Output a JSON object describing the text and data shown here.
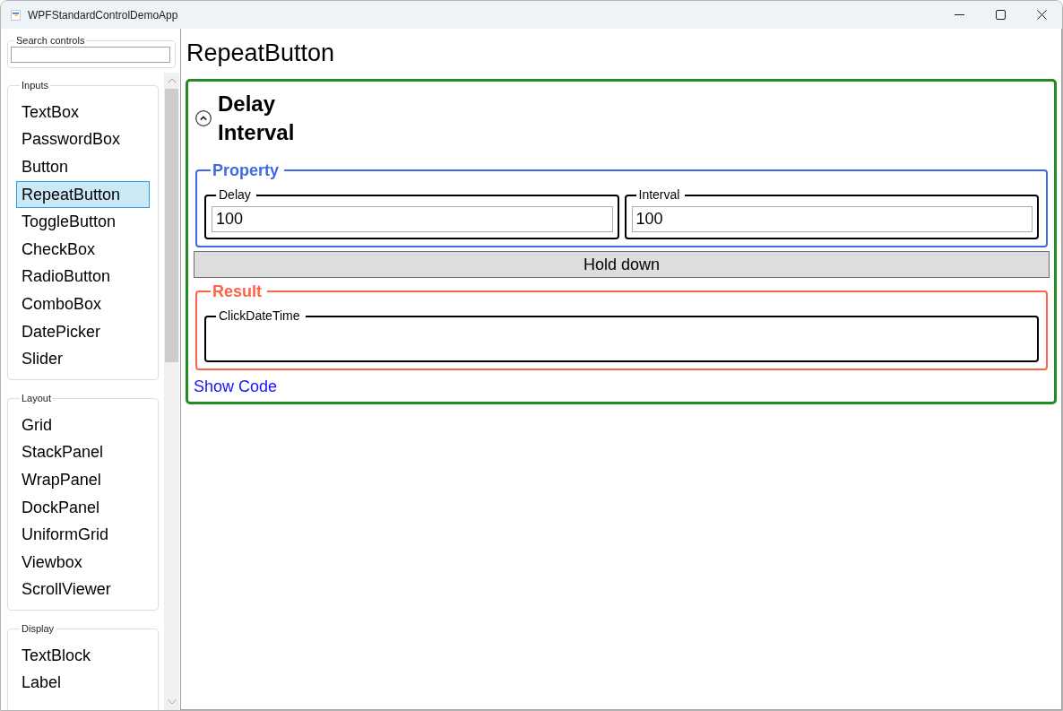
{
  "window": {
    "title": "WPFStandardControlDemoApp"
  },
  "sidebar": {
    "search": {
      "label": "Search controls"
    },
    "groups": [
      {
        "header": "Inputs",
        "items": [
          {
            "label": "TextBox",
            "selected": false
          },
          {
            "label": "PasswordBox",
            "selected": false
          },
          {
            "label": "Button",
            "selected": false
          },
          {
            "label": "RepeatButton",
            "selected": true
          },
          {
            "label": "ToggleButton",
            "selected": false
          },
          {
            "label": "CheckBox",
            "selected": false
          },
          {
            "label": "RadioButton",
            "selected": false
          },
          {
            "label": "ComboBox",
            "selected": false
          },
          {
            "label": "DatePicker",
            "selected": false
          },
          {
            "label": "Slider",
            "selected": false
          }
        ]
      },
      {
        "header": "Layout",
        "items": [
          {
            "label": "Grid",
            "selected": false
          },
          {
            "label": "StackPanel",
            "selected": false
          },
          {
            "label": "WrapPanel",
            "selected": false
          },
          {
            "label": "DockPanel",
            "selected": false
          },
          {
            "label": "UniformGrid",
            "selected": false
          },
          {
            "label": "Viewbox",
            "selected": false
          },
          {
            "label": "ScrollViewer",
            "selected": false
          }
        ]
      },
      {
        "header": "Display",
        "items": [
          {
            "label": "TextBlock",
            "selected": false
          },
          {
            "label": "Label",
            "selected": false
          }
        ]
      }
    ]
  },
  "page": {
    "title": "RepeatButton",
    "expander": {
      "expanded": true,
      "header_lines": [
        "Delay",
        "Interval"
      ],
      "property_group": {
        "header": "Property",
        "fields": [
          {
            "label": "Delay",
            "value": "100"
          },
          {
            "label": "Interval",
            "value": "100"
          }
        ]
      },
      "hold_button": "Hold down",
      "result_group": {
        "header": "Result",
        "fields": [
          {
            "label": "ClickDateTime"
          }
        ]
      }
    },
    "show_code_link": "Show Code"
  }
}
